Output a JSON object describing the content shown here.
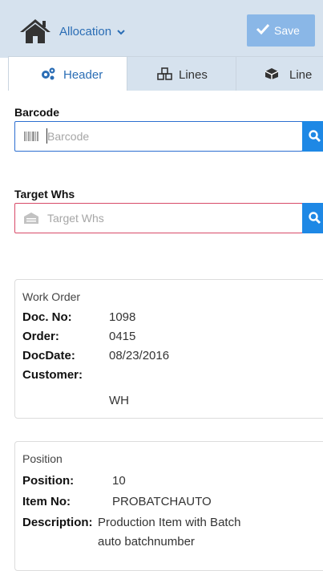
{
  "header": {
    "menu_label": "Allocation",
    "save_label": "Save"
  },
  "tabs": [
    {
      "label": "Header",
      "icon": "cogs-icon"
    },
    {
      "label": "Lines",
      "icon": "cubes-icon"
    },
    {
      "label": "Line",
      "icon": "cube-icon"
    }
  ],
  "barcode": {
    "label": "Barcode",
    "placeholder": "Barcode"
  },
  "target_whs": {
    "label": "Target Whs",
    "placeholder": "Target Whs"
  },
  "work_order": {
    "title": "Work Order",
    "doc_no_label": "Doc. No:",
    "doc_no": "1098",
    "order_label": "Order:",
    "order": "0415",
    "docdate_label": "DocDate:",
    "docdate": "08/23/2016",
    "customer_label": "Customer:",
    "customer": "WH"
  },
  "position": {
    "title": "Position",
    "position_label": "Position:",
    "position": "10",
    "item_no_label": "Item No:",
    "item_no": "PROBATCHAUTO",
    "description_label": "Description:",
    "description_line1": "Production Item with Batch",
    "description_line2": "auto batchnumber"
  },
  "colors": {
    "accent": "#1e88e5",
    "header_bg": "#d6e2ee",
    "link": "#2a6db5",
    "error_border": "#d84a68"
  }
}
